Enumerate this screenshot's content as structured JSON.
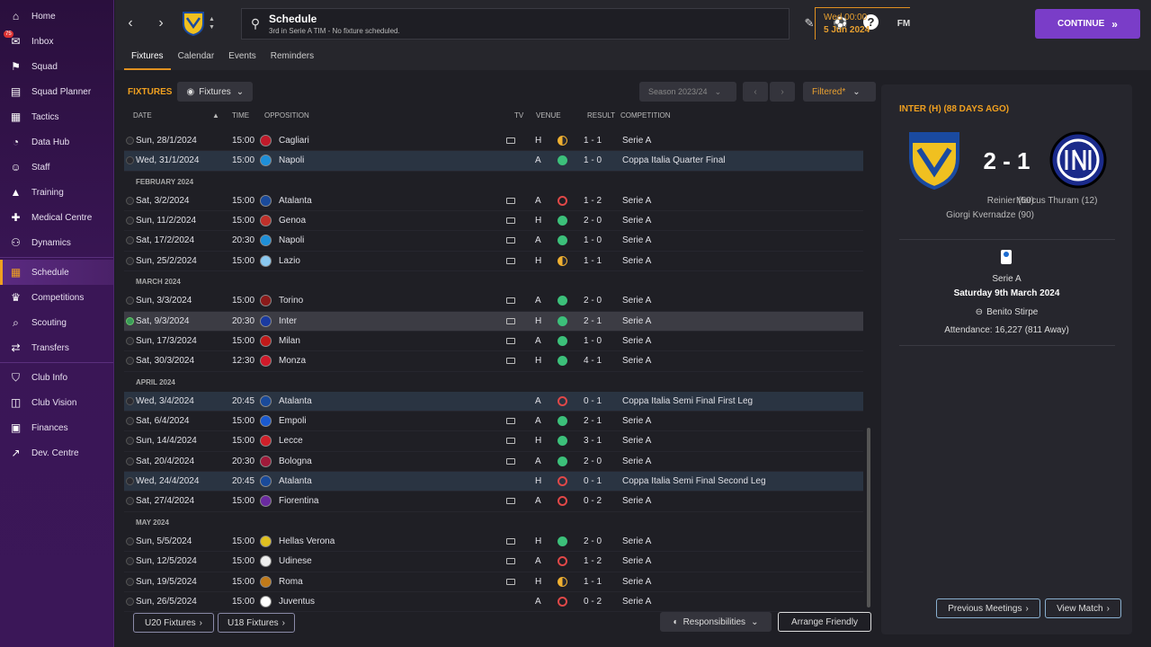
{
  "sidebar": {
    "items": [
      {
        "label": "Home",
        "icon": "home-icon"
      },
      {
        "label": "Inbox",
        "icon": "inbox-icon",
        "badge": "75"
      },
      {
        "label": "Squad",
        "icon": "squad-icon"
      },
      {
        "label": "Squad Planner",
        "icon": "clipboard-icon"
      },
      {
        "label": "Tactics",
        "icon": "tactics-icon"
      },
      {
        "label": "Data Hub",
        "icon": "data-hub-icon"
      },
      {
        "label": "Staff",
        "icon": "staff-icon"
      },
      {
        "label": "Training",
        "icon": "training-icon"
      },
      {
        "label": "Medical Centre",
        "icon": "medical-icon"
      },
      {
        "label": "Dynamics",
        "icon": "dynamics-icon"
      },
      {
        "label": "Schedule",
        "icon": "calendar-icon",
        "active": true
      },
      {
        "label": "Competitions",
        "icon": "trophy-icon"
      },
      {
        "label": "Scouting",
        "icon": "scouting-icon"
      },
      {
        "label": "Transfers",
        "icon": "transfers-icon"
      },
      {
        "label": "Club Info",
        "icon": "shield-icon"
      },
      {
        "label": "Club Vision",
        "icon": "vision-icon"
      },
      {
        "label": "Finances",
        "icon": "finances-icon"
      },
      {
        "label": "Dev. Centre",
        "icon": "dev-centre-icon"
      }
    ]
  },
  "header": {
    "title": "Schedule",
    "subtitle": "3rd in Serie A TIM - No fixture scheduled.",
    "fm_label": "FM",
    "date_line1": "Wed 00:00",
    "date_line2": "5 Jun 2024",
    "continue_label": "CONTINUE"
  },
  "tabs": [
    "Fixtures",
    "Calendar",
    "Events",
    "Reminders"
  ],
  "fixtures": {
    "title": "FIXTURES",
    "view_dropdown": "Fixtures",
    "season": "Season 2023/24",
    "filter": "Filtered*",
    "columns": {
      "date": "DATE",
      "time": "TIME",
      "opposition": "OPPOSITION",
      "tv": "TV",
      "venue": "VENUE",
      "result": "RESULT",
      "competition": "COMPETITION"
    },
    "rows": [
      {
        "date": "Sun, 28/1/2024",
        "time": "15:00",
        "opp": "Cagliari",
        "tv": true,
        "venue": "H",
        "res": "d",
        "score": "1 - 1",
        "comp": "Serie A",
        "crest": "#c01a2a"
      },
      {
        "date": "Wed, 31/1/2024",
        "time": "15:00",
        "opp": "Napoli",
        "tv": false,
        "venue": "A",
        "res": "w",
        "score": "1 - 0",
        "comp": "Coppa Italia Quarter Final",
        "hl": true,
        "crest": "#1e8fd8"
      },
      {
        "month": "FEBRUARY 2024"
      },
      {
        "date": "Sat, 3/2/2024",
        "time": "15:00",
        "opp": "Atalanta",
        "tv": true,
        "venue": "A",
        "res": "l",
        "score": "1 - 2",
        "comp": "Serie A",
        "crest": "#1a4a9a"
      },
      {
        "date": "Sun, 11/2/2024",
        "time": "15:00",
        "opp": "Genoa",
        "tv": true,
        "venue": "H",
        "res": "w",
        "score": "2 - 0",
        "comp": "Serie A",
        "crest": "#c0302a"
      },
      {
        "date": "Sat, 17/2/2024",
        "time": "20:30",
        "opp": "Napoli",
        "tv": true,
        "venue": "A",
        "res": "w",
        "score": "1 - 0",
        "comp": "Serie A",
        "crest": "#1e8fd8"
      },
      {
        "date": "Sun, 25/2/2024",
        "time": "15:00",
        "opp": "Lazio",
        "tv": true,
        "venue": "H",
        "res": "d",
        "score": "1 - 1",
        "comp": "Serie A",
        "crest": "#8ac8f0"
      },
      {
        "month": "MARCH 2024"
      },
      {
        "date": "Sun, 3/3/2024",
        "time": "15:00",
        "opp": "Torino",
        "tv": true,
        "venue": "A",
        "res": "w",
        "score": "2 - 0",
        "comp": "Serie A",
        "crest": "#8a1a1a"
      },
      {
        "date": "Sat, 9/3/2024",
        "time": "20:30",
        "opp": "Inter",
        "tv": true,
        "venue": "H",
        "res": "w",
        "score": "2 - 1",
        "comp": "Serie A",
        "sel": true,
        "crest": "#1a3aa0"
      },
      {
        "date": "Sun, 17/3/2024",
        "time": "15:00",
        "opp": "Milan",
        "tv": true,
        "venue": "A",
        "res": "w",
        "score": "1 - 0",
        "comp": "Serie A",
        "crest": "#c01a1a"
      },
      {
        "date": "Sat, 30/3/2024",
        "time": "12:30",
        "opp": "Monza",
        "tv": true,
        "venue": "H",
        "res": "w",
        "score": "4 - 1",
        "comp": "Serie A",
        "crest": "#d01a2a"
      },
      {
        "month": "APRIL 2024"
      },
      {
        "date": "Wed, 3/4/2024",
        "time": "20:45",
        "opp": "Atalanta",
        "tv": false,
        "venue": "A",
        "res": "l",
        "score": "0 - 1",
        "comp": "Coppa Italia Semi Final First Leg",
        "hl": true,
        "crest": "#1a4a9a"
      },
      {
        "date": "Sat, 6/4/2024",
        "time": "15:00",
        "opp": "Empoli",
        "tv": true,
        "venue": "A",
        "res": "w",
        "score": "2 - 1",
        "comp": "Serie A",
        "crest": "#1a5ad0"
      },
      {
        "date": "Sun, 14/4/2024",
        "time": "15:00",
        "opp": "Lecce",
        "tv": true,
        "venue": "H",
        "res": "w",
        "score": "3 - 1",
        "comp": "Serie A",
        "crest": "#d0202a"
      },
      {
        "date": "Sat, 20/4/2024",
        "time": "20:30",
        "opp": "Bologna",
        "tv": true,
        "venue": "A",
        "res": "w",
        "score": "2 - 0",
        "comp": "Serie A",
        "crest": "#a01a3a"
      },
      {
        "date": "Wed, 24/4/2024",
        "time": "20:45",
        "opp": "Atalanta",
        "tv": false,
        "venue": "H",
        "res": "l",
        "score": "0 - 1",
        "comp": "Coppa Italia Semi Final Second Leg",
        "hl": true,
        "crest": "#1a4a9a"
      },
      {
        "date": "Sat, 27/4/2024",
        "time": "15:00",
        "opp": "Fiorentina",
        "tv": true,
        "venue": "A",
        "res": "l",
        "score": "0 - 2",
        "comp": "Serie A",
        "crest": "#6a2aa0"
      },
      {
        "month": "MAY 2024"
      },
      {
        "date": "Sun, 5/5/2024",
        "time": "15:00",
        "opp": "Hellas Verona",
        "tv": true,
        "venue": "H",
        "res": "w",
        "score": "2 - 0",
        "comp": "Serie A",
        "crest": "#e0c020"
      },
      {
        "date": "Sun, 12/5/2024",
        "time": "15:00",
        "opp": "Udinese",
        "tv": true,
        "venue": "A",
        "res": "l",
        "score": "1 - 2",
        "comp": "Serie A",
        "crest": "#eeeeee"
      },
      {
        "date": "Sun, 19/5/2024",
        "time": "15:00",
        "opp": "Roma",
        "tv": true,
        "venue": "H",
        "res": "d",
        "score": "1 - 1",
        "comp": "Serie A",
        "crest": "#c07a1a"
      },
      {
        "date": "Sun, 26/5/2024",
        "time": "15:00",
        "opp": "Juventus",
        "tv": false,
        "venue": "A",
        "res": "l",
        "score": "0 - 2",
        "comp": "Serie A",
        "crest": "#ffffff"
      }
    ],
    "u20_label": "U20 Fixtures",
    "u18_label": "U18 Fixtures",
    "responsibilities_label": "Responsibilities",
    "arrange_label": "Arrange Friendly"
  },
  "match": {
    "title": "INTER (H) (88 DAYS AGO)",
    "score": "2 - 1",
    "home_scorers": [
      "Reinier (50)",
      "Giorgi Kvernadze (90)"
    ],
    "away_scorers": [
      "Marcus Thuram (12)"
    ],
    "competition": "Serie A",
    "date": "Saturday 9th March 2024",
    "stadium": "Benito Stirpe",
    "attendance": "Attendance: 16,227 (811 Away)",
    "prev_label": "Previous Meetings",
    "view_label": "View Match"
  }
}
